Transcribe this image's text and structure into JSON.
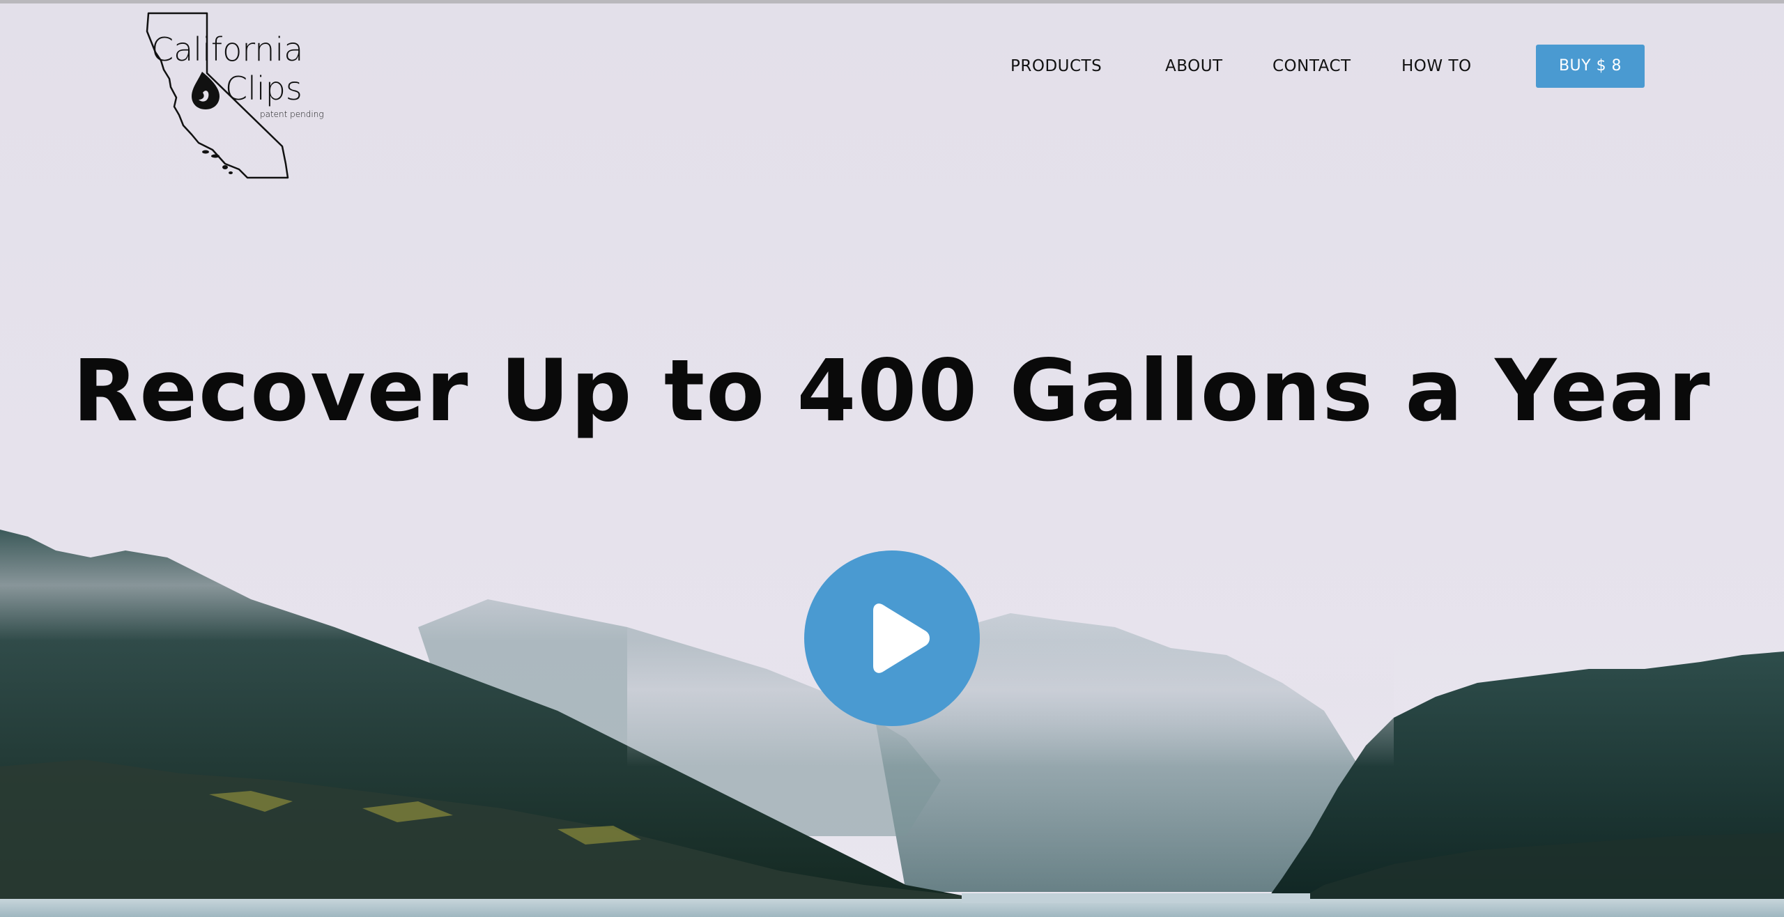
{
  "header": {
    "logo": {
      "line1": "California",
      "line2": "Clips",
      "tagline": "patent pending",
      "icon": "california-outline-water-drop-logo"
    },
    "nav": {
      "items": [
        {
          "label": "PRODUCTS"
        },
        {
          "label": "ABOUT"
        },
        {
          "label": "CONTACT"
        },
        {
          "label": "HOW TO"
        }
      ],
      "buy_label": "BUY $ 8"
    }
  },
  "hero": {
    "headline": "Recover Up to 400 Gallons a Year",
    "play_icon": "play-icon",
    "background": "misty-forest-coastline"
  },
  "colors": {
    "accent": "#4a9ad1",
    "text": "#0a0a0a",
    "sky": "#e4e0ea"
  }
}
